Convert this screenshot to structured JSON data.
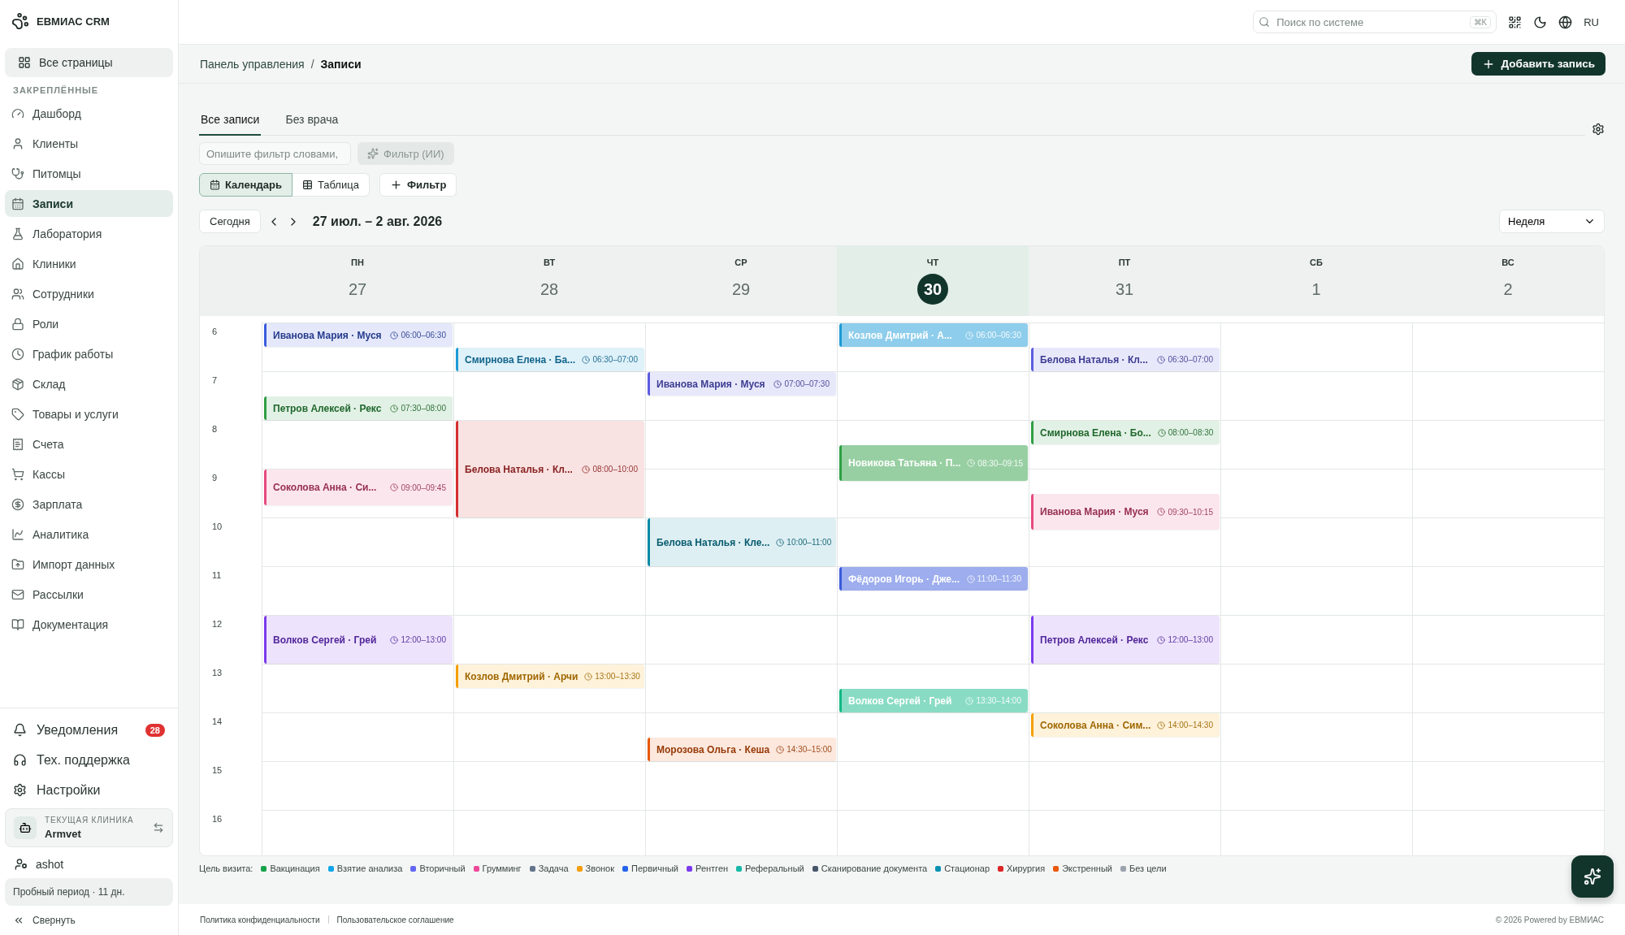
{
  "brand": {
    "name": "ЕВМИАС CRM"
  },
  "sidebar": {
    "all_pages": "Все страницы",
    "section": "ЗАКРЕПЛЁННЫЕ",
    "items": [
      {
        "label": "Дашборд",
        "selected": false
      },
      {
        "label": "Клиенты",
        "selected": false
      },
      {
        "label": "Питомцы",
        "selected": false
      },
      {
        "label": "Записи",
        "selected": true
      },
      {
        "label": "Лаборатория",
        "selected": false
      },
      {
        "label": "Клиники",
        "selected": false
      },
      {
        "label": "Сотрудники",
        "selected": false
      },
      {
        "label": "Роли",
        "selected": false
      },
      {
        "label": "График работы",
        "selected": false
      },
      {
        "label": "Склад",
        "selected": false
      },
      {
        "label": "Товары и услуги",
        "selected": false
      },
      {
        "label": "Счета",
        "selected": false
      },
      {
        "label": "Кассы",
        "selected": false
      },
      {
        "label": "Зарплата",
        "selected": false
      },
      {
        "label": "Аналитика",
        "selected": false
      },
      {
        "label": "Импорт данных",
        "selected": false
      },
      {
        "label": "Рассылки",
        "selected": false
      },
      {
        "label": "Документация",
        "selected": false
      }
    ],
    "bottom_items": [
      {
        "label": "Уведомления",
        "badge": "28"
      },
      {
        "label": "Тех. поддержка"
      },
      {
        "label": "Настройки"
      }
    ],
    "clinic": {
      "caption": "ТЕКУЩАЯ КЛИНИКА",
      "name": "Armvet"
    },
    "user": "ashot",
    "trial": "Пробный период · 11 дн.",
    "collapse": "Свернуть"
  },
  "topbar": {
    "search_placeholder": "Поиск по системе",
    "shortcut": "⌘K",
    "language": "RU"
  },
  "breadcrumbs": [
    "Панель управления",
    "Записи"
  ],
  "breadcrumb_separator": "/",
  "add_button": "Добавить запись",
  "tabs": [
    {
      "label": "Все записи",
      "selected": true
    },
    {
      "label": "Без врача",
      "selected": false
    }
  ],
  "ai_filter": {
    "placeholder": "Опишите фильтр словами,",
    "button": "Фильтр (ИИ)",
    "disabled": true
  },
  "views": [
    {
      "label": "Календарь",
      "selected": true
    },
    {
      "label": "Таблица",
      "selected": false
    }
  ],
  "filter_button": "Фильтр",
  "nav": {
    "today": "Сегодня",
    "range": "27 июл. – 2 авг. 2026",
    "period": "Неделя"
  },
  "days": [
    {
      "weekday": "ПН",
      "date": "27",
      "today": false,
      "events": [
        {
          "title": "Иванова Мария · Муся",
          "time": "06:00–06:30",
          "color": "#3b5bdb",
          "solid": false
        },
        {
          "title": "Петров Алексей · Рекс",
          "time": "07:30–08:00",
          "color": "#2f9e44",
          "solid": false
        },
        {
          "title": "Соколова Анна · Си...",
          "time": "09:00–09:45",
          "color": "#e64980",
          "solid": false
        },
        {
          "title": "Волков Сергей · Грей",
          "time": "12:00–13:00",
          "color": "#7c3aed",
          "solid": false
        }
      ]
    },
    {
      "weekday": "ВТ",
      "date": "28",
      "today": false,
      "events": [
        {
          "title": "Смирнова Елена · Ба...",
          "time": "06:30–07:00",
          "color": "#1c9ad6",
          "solid": false
        },
        {
          "title": "Белова Наталья · Кл...",
          "time": "08:00–10:00",
          "color": "#d32f2f",
          "solid": false
        },
        {
          "title": "Козлов Дмитрий · Арчи",
          "time": "13:00–13:30",
          "color": "#f59f00",
          "solid": false
        }
      ]
    },
    {
      "weekday": "СР",
      "date": "29",
      "today": false,
      "events": [
        {
          "title": "Иванова Мария · Муся",
          "time": "07:00–07:30",
          "color": "#5c5ce0",
          "solid": false
        },
        {
          "title": "Белова Наталья · Кле...",
          "time": "10:00–11:00",
          "color": "#0b8aa8",
          "solid": false
        },
        {
          "title": "Морозова Ольга · Кеша",
          "time": "14:30–15:00",
          "color": "#e8590c",
          "solid": false
        }
      ]
    },
    {
      "weekday": "ЧТ",
      "date": "30",
      "today": true,
      "events": [
        {
          "title": "Козлов Дмитрий · А...",
          "time": "06:00–06:30",
          "color": "#1c9ad6",
          "solid": true
        },
        {
          "title": "Новикова Татьяна · П...",
          "time": "08:30–09:15",
          "color": "#2f9e44",
          "solid": true
        },
        {
          "title": "Фёдоров Игорь · Дже...",
          "time": "11:00–11:30",
          "color": "#3b5bdb",
          "solid": true
        },
        {
          "title": "Волков Сергей · Грей",
          "time": "13:30–14:00",
          "color": "#12b886",
          "solid": true
        }
      ]
    },
    {
      "weekday": "ПТ",
      "date": "31",
      "today": false,
      "events": [
        {
          "title": "Белова Наталья · Кл...",
          "time": "06:30–07:00",
          "color": "#5c5ce0",
          "solid": false
        },
        {
          "title": "Смирнова Елена · Бо...",
          "time": "08:00–08:30",
          "color": "#2f9e44",
          "solid": false
        },
        {
          "title": "Иванова Мария · Муся",
          "time": "09:30–10:15",
          "color": "#e64980",
          "solid": false
        },
        {
          "title": "Петров Алексей · Рекс",
          "time": "12:00–13:00",
          "color": "#7c3aed",
          "solid": false
        },
        {
          "title": "Соколова Анна · Сим...",
          "time": "14:00–14:30",
          "color": "#f59f00",
          "solid": false
        }
      ]
    },
    {
      "weekday": "СБ",
      "date": "1",
      "today": false
    },
    {
      "weekday": "ВС",
      "date": "2",
      "today": false
    }
  ],
  "hours": [
    "6",
    "7",
    "8",
    "9",
    "10",
    "11",
    "12",
    "13",
    "14",
    "15",
    "16"
  ],
  "legend": {
    "label": "Цель визита:",
    "items": [
      {
        "label": "Вакцинация",
        "color": "#16a34a"
      },
      {
        "label": "Взятие анализа",
        "color": "#0ea5e9"
      },
      {
        "label": "Вторичный",
        "color": "#6366f1"
      },
      {
        "label": "Грумминг",
        "color": "#ec4899"
      },
      {
        "label": "Задача",
        "color": "#64748b"
      },
      {
        "label": "Звонок",
        "color": "#f59e0b"
      },
      {
        "label": "Первичный",
        "color": "#2563eb"
      },
      {
        "label": "Рентген",
        "color": "#7c3aed"
      },
      {
        "label": "Реферальный",
        "color": "#14b8a6"
      },
      {
        "label": "Сканирование документа",
        "color": "#475569"
      },
      {
        "label": "Стационар",
        "color": "#0891b2"
      },
      {
        "label": "Хирургия",
        "color": "#dc2626"
      },
      {
        "label": "Экстренный",
        "color": "#ea580c"
      },
      {
        "label": "Без цели",
        "color": "#9ca3af"
      }
    ]
  },
  "footer": {
    "links": [
      "Политика конфиденциальности",
      "Пользовательское соглашение"
    ],
    "copyright": "© 2026 Powered by ЕВМИАС"
  }
}
